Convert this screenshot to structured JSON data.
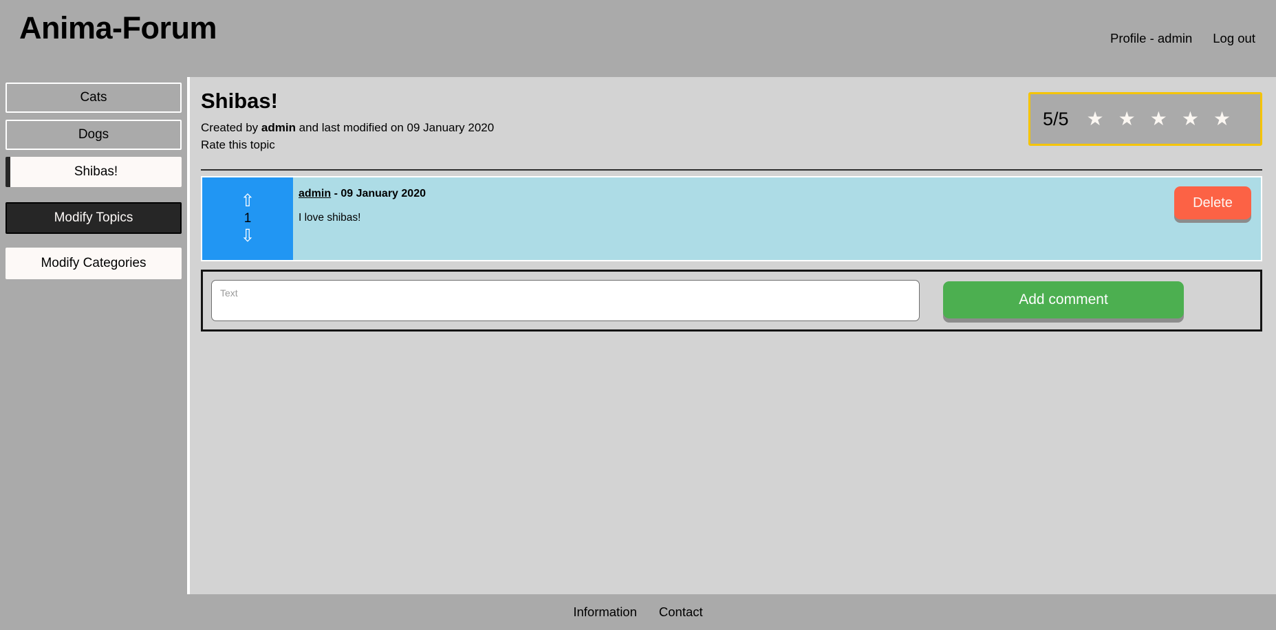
{
  "header": {
    "brand": "Anima-Forum",
    "links": [
      {
        "label": "Profile - admin",
        "name": "profile-link"
      },
      {
        "label": "Log out",
        "name": "logout-link"
      }
    ]
  },
  "sidebar": {
    "items": [
      {
        "label": "Cats",
        "style": "plain",
        "active": false
      },
      {
        "label": "Dogs",
        "style": "plain",
        "active": false
      },
      {
        "label": "Shibas!",
        "style": "active",
        "active": true
      },
      {
        "label": "Modify Topics",
        "style": "dark",
        "active": false
      },
      {
        "label": "Modify Categories",
        "style": "light",
        "active": false
      }
    ]
  },
  "topic": {
    "title": "Shibas!",
    "created_by_prefix": "Created by ",
    "author": "admin",
    "modified_suffix": " and last modified on 09 January 2020",
    "rate_prompt": "Rate this topic"
  },
  "rating": {
    "score_label": "5/5",
    "value": 5,
    "max": 5,
    "star_glyph": "★",
    "border_color": "#f5c400",
    "star_color": "#fbf7f2"
  },
  "comments": [
    {
      "author": "admin",
      "date_separator": " - ",
      "date": "09 January 2020",
      "text": "I love shibas!",
      "votes": "1",
      "upvote_glyph": "⇧",
      "downvote_glyph": "⇩",
      "delete_label": "Delete",
      "vote_bg": "#2196f3",
      "body_bg": "#addce6",
      "delete_color": "#fc6245"
    }
  ],
  "comment_form": {
    "placeholder": "Text",
    "value": "",
    "submit_label": "Add comment",
    "submit_color": "#4caf50"
  },
  "footer": {
    "links": [
      {
        "label": "Information",
        "name": "information-link"
      },
      {
        "label": "Contact",
        "name": "contact-link"
      }
    ]
  }
}
